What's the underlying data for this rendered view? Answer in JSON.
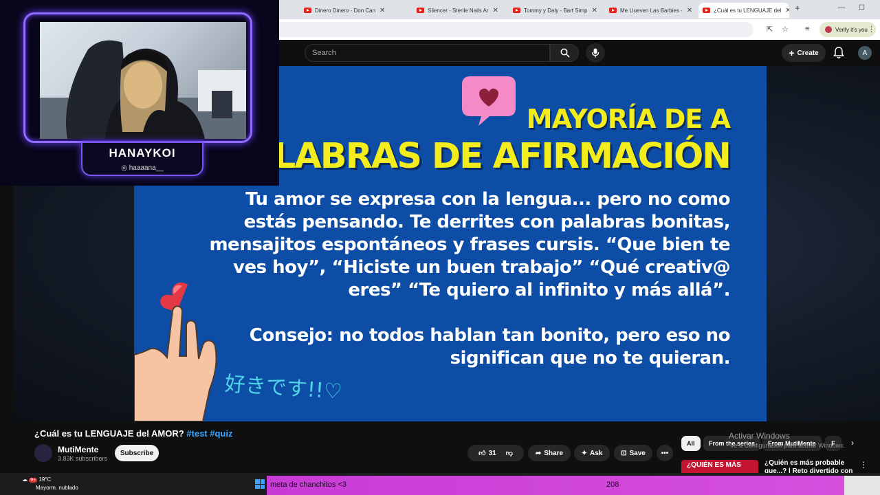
{
  "browser": {
    "tabs": [
      {
        "title": "Dinero Dinero - Don Can"
      },
      {
        "title": "Silencer - Sterile Nails Ar"
      },
      {
        "title": "Tommy y Daly - Bart Simp"
      },
      {
        "title": "Me Llueven Las Barbies -"
      },
      {
        "title": "¿Cuál es tu LENGUAJE del"
      }
    ],
    "new_tab": "+",
    "verify_label": "Verify it's you"
  },
  "youtube": {
    "search_placeholder": "Search",
    "create_label": "Create",
    "avatar_letter": "A"
  },
  "slide": {
    "header": "MAYORÍA DE A",
    "title": "PALABRAS DE AFIRMACIÓN",
    "body": "Tu amor se expresa con la lengua... pero no como estás pensando. Te derrites con palabras bonitas, mensajitos espontáneos y frases cursis. “Que bien te ves hoy”, “Hiciste un buen trabajo” “Qué creativ@ eres” “Te quiero al infinito y más allá”.",
    "tip": "Consejo: no todos hablan tan bonito, pero eso no significan que no te quieran.",
    "japanese": "好きです!!♡"
  },
  "webcam": {
    "name": "HANAYKOI",
    "handle": "haaaana__"
  },
  "video": {
    "title": "¿Cuál es tu LENGUAJE del AMOR?",
    "tags": "#test #quiz",
    "channel": "MutiMente",
    "subscribers": "3.83K subscribers",
    "subscribe_label": "Subscribe",
    "like_count": "31",
    "share_label": "Share",
    "ask_label": "Ask",
    "save_label": "Save"
  },
  "sidebar": {
    "chips": [
      "All",
      "From the series",
      "From MutiMente",
      "F"
    ],
    "watermark": "Activar Windows",
    "watermark_sub": "Ve a Configuración para activar Windows.",
    "rec_thumb_text": "¿QUIÉN ES MÁS",
    "rec_title": "¿Quién es más probable que...? | Reto divertido con"
  },
  "taskbar": {
    "temperature": "19°C",
    "weather": "Mayorm. nublado",
    "weather_badge": "9+",
    "goal_label": "meta de chanchitos <3",
    "goal_count": "208"
  },
  "colors": {
    "slide_bg": "#0e4da5",
    "slide_yellow": "#f4ed1d",
    "goal_magenta": "#d64fdd",
    "cam_border": "#8f6bff"
  }
}
